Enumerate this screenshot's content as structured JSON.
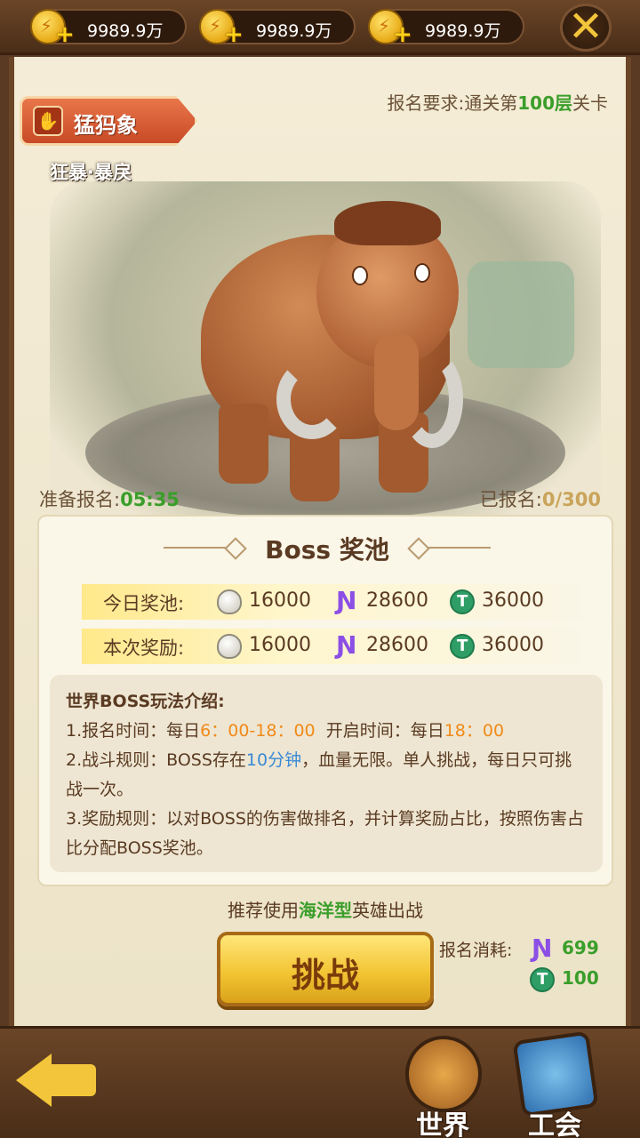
{
  "currencies": [
    {
      "amount": "9989.9万"
    },
    {
      "amount": "9989.9万"
    },
    {
      "amount": "9989.9万"
    }
  ],
  "icons": {
    "close": "close-icon",
    "coin": "coin-icon",
    "plus": "plus-icon",
    "shell": "shell-icon",
    "energy": "energy-icon",
    "token": "token-icon",
    "back": "back-arrow-icon",
    "world": "world-icon",
    "guild": "guild-book-icon"
  },
  "boss": {
    "name": "猛犸象",
    "trait": "狂暴·暴戾",
    "requirement_prefix": "报名要求:通关第",
    "requirement_level": "100层",
    "requirement_suffix": "关卡"
  },
  "status": {
    "prepare_label": "准备报名:",
    "prepare_time": "05:35",
    "signed_label": "已报名:",
    "signed_value": "0/300"
  },
  "reward_pool": {
    "title": "Boss 奖池",
    "rows": [
      {
        "label": "今日奖池:",
        "shell": "16000",
        "energy": "28600",
        "token": "36000"
      },
      {
        "label": "本次奖励:",
        "shell": "16000",
        "energy": "28600",
        "token": "36000"
      }
    ]
  },
  "rules": {
    "heading": "世界BOSS玩法介绍:",
    "line1_a": "1.报名时间：每日",
    "line1_b": "6：00-18：00",
    "line1_c": "  开启时间：每日",
    "line1_d": "18：00",
    "line2_a": "2.战斗规则：BOSS存在",
    "line2_b": "10分钟",
    "line2_c": "，血量无限。单人挑战，每日只可挑战一次。",
    "line3": "3.奖励规则：以对BOSS的伤害做排名，并计算奖励占比，按照伤害占比分配BOSS奖池。"
  },
  "recommend": {
    "prefix": "推荐使用",
    "type": "海洋型",
    "suffix": "英雄出战"
  },
  "challenge": {
    "label": "挑战",
    "cost_label": "报名消耗:",
    "cost_energy": "699",
    "cost_token": "100"
  },
  "nav": {
    "world": "世界",
    "guild": "工会"
  },
  "colors": {
    "accent_green": "#3a9e2a",
    "accent_orange": "#f08a1a",
    "accent_blue": "#3a8ad6",
    "gold": "#f2c53a"
  }
}
